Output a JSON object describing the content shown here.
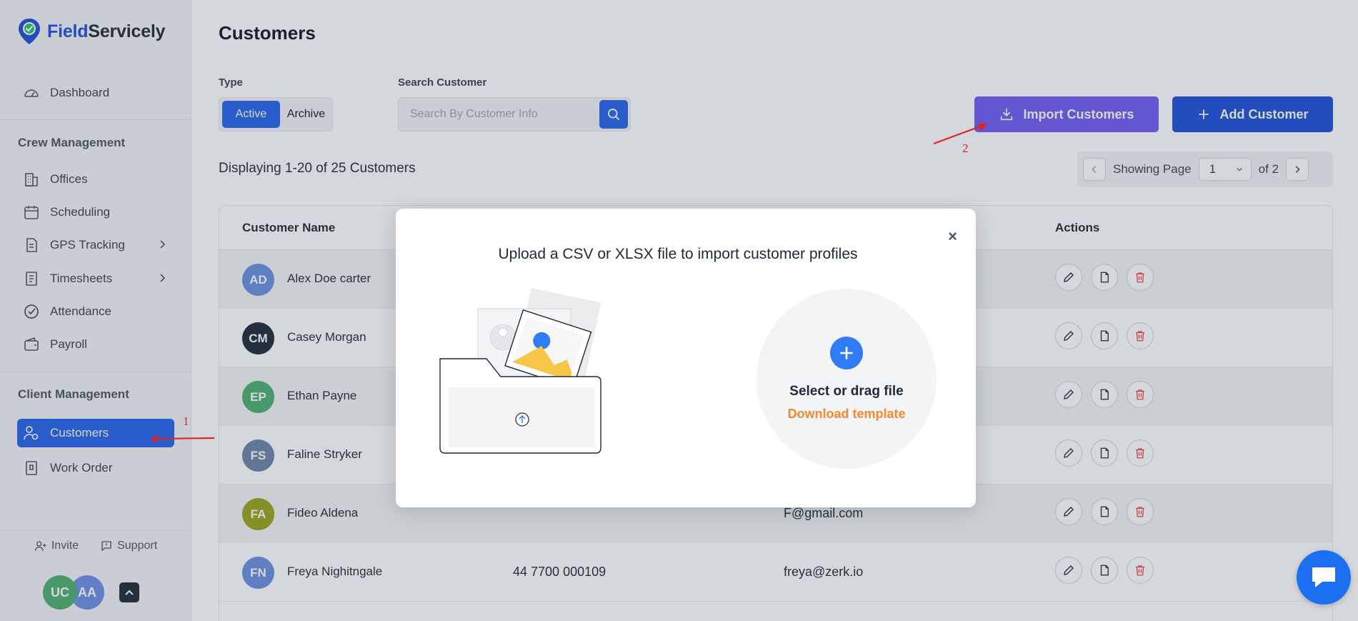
{
  "brand": {
    "name_part1": "Field",
    "name_part2": "Servicely"
  },
  "sidebar": {
    "dashboard": "Dashboard",
    "crew_section": "Crew Management",
    "crew_items": [
      "Offices",
      "Scheduling",
      "GPS Tracking",
      "Timesheets",
      "Attendance",
      "Payroll"
    ],
    "client_section": "Client Management",
    "client_items": [
      "Customers",
      "Work Order"
    ],
    "invite": "Invite",
    "support": "Support",
    "avatar_1": "UC",
    "avatar_2": "AA"
  },
  "main": {
    "title": "Customers",
    "type_label": "Type",
    "type_active": "Active",
    "type_archive": "Archive",
    "search_label": "Search Customer",
    "search_placeholder": "Search By Customer Info",
    "import_button": "Import Customers",
    "add_button": "Add Customer",
    "display_count": "Displaying 1-20 of 25 Customers",
    "pager": {
      "prefix": "Showing Page",
      "page": "1",
      "suffix": "of 2"
    }
  },
  "table": {
    "headers": {
      "name": "Customer Name",
      "actions": "Actions"
    },
    "rows": [
      {
        "initials": "AD",
        "name": "Alex Doe carter",
        "phone": "",
        "email": "",
        "color": "#6b8fe0"
      },
      {
        "initials": "CM",
        "name": "Casey Morgan",
        "phone": "",
        "email": "",
        "color": "#1f2937"
      },
      {
        "initials": "EP",
        "name": "Ethan Payne",
        "phone": "",
        "email": "",
        "color": "#4caf6e"
      },
      {
        "initials": "FS",
        "name": "Faline Stryker",
        "phone": "",
        "email": "",
        "color": "#6f83a8"
      },
      {
        "initials": "FA",
        "name": "Fideo Aldena",
        "phone": "",
        "email": "F@gmail.com",
        "color": "#9aa51c"
      },
      {
        "initials": "FN",
        "name": "Freya Nighitngale",
        "phone": "44 7700 000109",
        "email": "freya@zerk.io",
        "color": "#6b8fe0"
      }
    ]
  },
  "modal": {
    "title": "Upload a CSV or XLSX file to import customer profiles",
    "close": "×",
    "select_text": "Select or drag file",
    "download_template": "Download template"
  },
  "annotations": {
    "first": "1",
    "second": "2"
  },
  "colors": {
    "primary": "#2563eb",
    "import": "#6d5bf2",
    "template": "#f5892e",
    "annotation": "#dc2626"
  }
}
